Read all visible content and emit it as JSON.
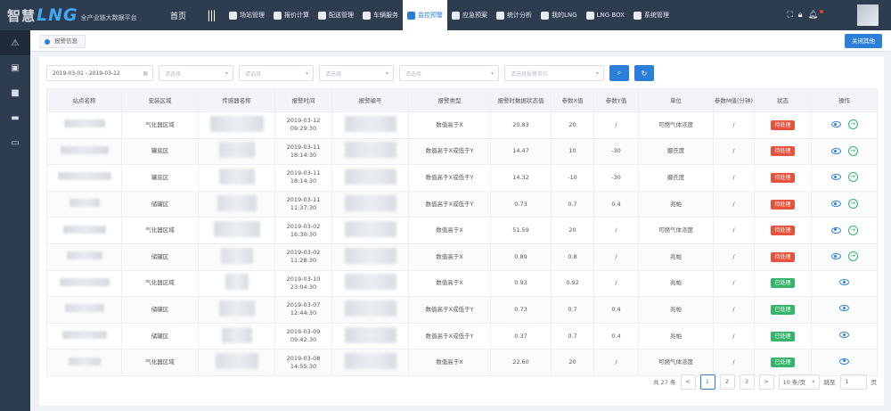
{
  "app": {
    "logo_zh": "智慧",
    "logo_en": "LNG",
    "logo_sub": "全产业链大数据平台",
    "home": "首页",
    "toggle": "|||"
  },
  "menu": [
    {
      "label": "场站管理",
      "icon": "station-icon",
      "active": false
    },
    {
      "label": "报价计算",
      "icon": "calculator-icon",
      "active": false
    },
    {
      "label": "配送管理",
      "icon": "truck-icon",
      "active": false
    },
    {
      "label": "车辆服务",
      "icon": "car-icon",
      "active": false
    },
    {
      "label": "监控预警",
      "icon": "monitor-icon",
      "active": true
    },
    {
      "label": "应急预案",
      "icon": "emergency-icon",
      "active": false
    },
    {
      "label": "统计分析",
      "icon": "chart-icon",
      "active": false
    },
    {
      "label": "我的LNG",
      "icon": "user-icon",
      "active": false
    },
    {
      "label": "LNG BOX",
      "icon": "box-icon",
      "active": false
    },
    {
      "label": "系统管理",
      "icon": "settings-icon",
      "active": false
    }
  ],
  "tab": {
    "label": "报警信息"
  },
  "close_button": "关闭其他",
  "filters": {
    "date_range": "2019-03-01 - 2019-03-12",
    "select_1": "请选择",
    "select_2": "请选择",
    "select_3": "请选择",
    "select_4": "请选择",
    "select_5": "请选择报警单位"
  },
  "table": {
    "headers": [
      "站点名称",
      "安装区域",
      "传感器名称",
      "报警时间",
      "报警编号",
      "报警类型",
      "报警时数据状态值",
      "参数X值",
      "参数Y值",
      "单位",
      "参数M值(分钟)",
      "状态",
      "操作"
    ],
    "rows": [
      {
        "area": "气化器区域",
        "time": "2019-03-12\n09:29:30",
        "type": "数值高于X",
        "value": "20.83",
        "x": "20",
        "y": "/",
        "unit": "可燃气体浓度",
        "m": "/",
        "status": "待处理",
        "state": "pending"
      },
      {
        "area": "罐底区",
        "time": "2019-03-11\n18:14:30",
        "type": "数值高于X或低于Y",
        "value": "14.47",
        "x": "10",
        "y": "-30",
        "unit": "摄氏度",
        "m": "/",
        "status": "待处理",
        "state": "pending"
      },
      {
        "area": "罐底区",
        "time": "2019-03-11\n18:14:30",
        "type": "数值高于X或低于Y",
        "value": "14.32",
        "x": "-10",
        "y": "-30",
        "unit": "摄氏度",
        "m": "/",
        "status": "待处理",
        "state": "pending"
      },
      {
        "area": "储罐区",
        "time": "2019-03-11\n11:37:30",
        "type": "数值高于X或低于Y",
        "value": "0.73",
        "x": "0.7",
        "y": "0.4",
        "unit": "兆帕",
        "m": "/",
        "status": "待处理",
        "state": "pending"
      },
      {
        "area": "气化器区域",
        "time": "2019-03-02\n16:30:30",
        "type": "数值高于X",
        "value": "51.59",
        "x": "20",
        "y": "/",
        "unit": "可燃气体浓度",
        "m": "/",
        "status": "待处理",
        "state": "pending"
      },
      {
        "area": "储罐区",
        "time": "2019-03-02\n11:28:30",
        "type": "数值高于X",
        "value": "0.89",
        "x": "0.8",
        "y": "/",
        "unit": "兆帕",
        "m": "/",
        "status": "待处理",
        "state": "pending"
      },
      {
        "area": "气化器区域",
        "time": "2019-03-10\n23:04:30",
        "type": "数值高于X",
        "value": "0.93",
        "x": "0.92",
        "y": "/",
        "unit": "兆帕",
        "m": "/",
        "status": "已处理",
        "state": "done"
      },
      {
        "area": "储罐区",
        "time": "2019-03-07\n12:44:30",
        "type": "数值高于X或低于Y",
        "value": "0.73",
        "x": "0.7",
        "y": "0.4",
        "unit": "兆帕",
        "m": "/",
        "status": "已处理",
        "state": "done"
      },
      {
        "area": "储罐区",
        "time": "2019-03-09\n09:42:30",
        "type": "数值高于X或低于Y",
        "value": "0.37",
        "x": "0.7",
        "y": "0.4",
        "unit": "兆帕",
        "m": "/",
        "status": "已处理",
        "state": "done"
      },
      {
        "area": "气化器区域",
        "time": "2019-03-08\n14:55:30",
        "type": "数值高于X",
        "value": "22.60",
        "x": "20",
        "y": "/",
        "unit": "可燃气体浓度",
        "m": "/",
        "status": "已处理",
        "state": "done"
      }
    ]
  },
  "pager": {
    "total": "共 27 条",
    "prev": "<",
    "pages": [
      "1",
      "2",
      "3"
    ],
    "next": ">",
    "size": "10 条/页",
    "jump_label": "跳至",
    "jump_value": "1",
    "page_suffix": "页"
  },
  "colors": {
    "header_bg": "#2d3c4e",
    "accent": "#2b7fd9",
    "pending": "#e8513b",
    "done": "#35b56a"
  }
}
